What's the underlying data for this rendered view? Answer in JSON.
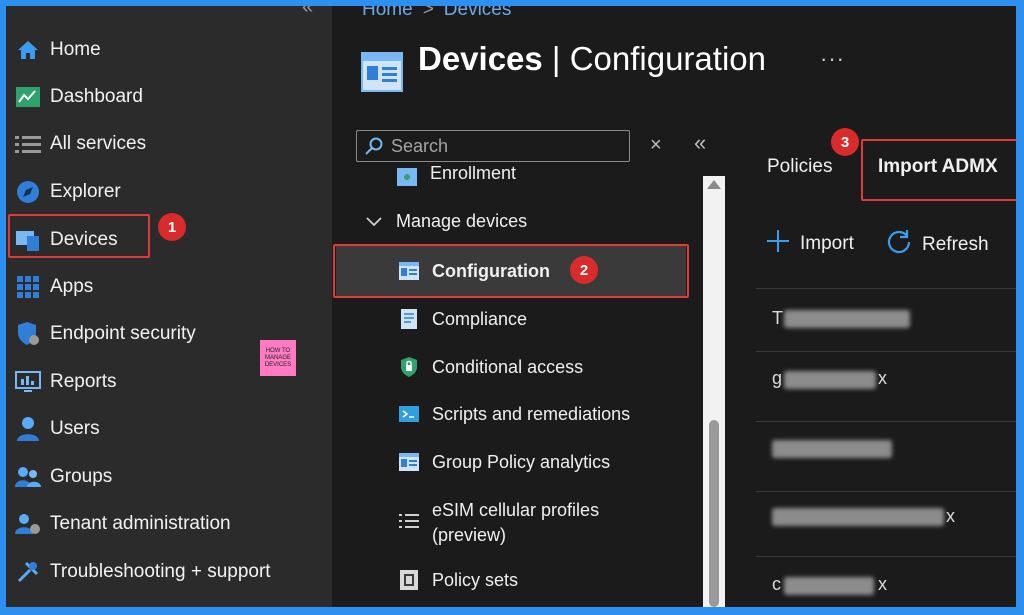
{
  "nav": {
    "collapse": "«",
    "items": [
      {
        "label": "Home",
        "icon": "home-icon"
      },
      {
        "label": "Dashboard",
        "icon": "dashboard-icon"
      },
      {
        "label": "All services",
        "icon": "list-icon"
      },
      {
        "label": "Explorer",
        "icon": "explorer-icon"
      },
      {
        "label": "Devices",
        "icon": "devices-icon"
      },
      {
        "label": "Apps",
        "icon": "apps-icon"
      },
      {
        "label": "Endpoint security",
        "icon": "shield-icon"
      },
      {
        "label": "Reports",
        "icon": "reports-icon"
      },
      {
        "label": "Users",
        "icon": "user-icon"
      },
      {
        "label": "Groups",
        "icon": "groups-icon"
      },
      {
        "label": "Tenant administration",
        "icon": "tenant-admin-icon"
      },
      {
        "label": "Troubleshooting + support",
        "icon": "wrench-icon"
      }
    ]
  },
  "logo": {
    "lines": [
      "HOW TO",
      "MANAGE",
      "DEVICES"
    ]
  },
  "breadcrumb": {
    "home": "Home",
    "sep": ">",
    "current": "Devices"
  },
  "page": {
    "title_bold": "Devices",
    "separator": " | ",
    "title_rest": "Configuration",
    "more": "···"
  },
  "search": {
    "placeholder": "Search",
    "clear": "×",
    "collapse": "«"
  },
  "menu": {
    "enrollment": "Enrollment",
    "group": "Manage devices",
    "items": [
      {
        "label": "Configuration",
        "icon": "configuration-icon",
        "selected": true
      },
      {
        "label": "Compliance",
        "icon": "compliance-icon"
      },
      {
        "label": "Conditional access",
        "icon": "lock-icon"
      },
      {
        "label": "Scripts and remediations",
        "icon": "script-icon"
      },
      {
        "label": "Group Policy analytics",
        "icon": "analytics-icon"
      },
      {
        "label": "eSIM cellular profiles",
        "label2": "(preview)",
        "icon": "esim-icon"
      },
      {
        "label": "Policy sets",
        "icon": "policy-sets-icon"
      }
    ]
  },
  "tabs": {
    "policies": "Policies",
    "import_admx": "Import ADMX"
  },
  "toolbar": {
    "import": "Import",
    "refresh": "Refresh"
  },
  "rows": [
    {
      "lead": "T"
    },
    {
      "lead": "g",
      "tail": "x"
    },
    {
      "lead": "",
      "tail": ""
    },
    {
      "lead": "",
      "tail": "x"
    },
    {
      "lead": "c",
      "tail": "x"
    }
  ],
  "annotations": {
    "step1": "1",
    "step2": "2",
    "step3": "3"
  },
  "colors": {
    "accent": "#2d8ff0",
    "highlight": "#e03a3a",
    "badge": "#d92b2b",
    "background": "#1b1b1b",
    "sidebar": "#2b2b2b"
  }
}
